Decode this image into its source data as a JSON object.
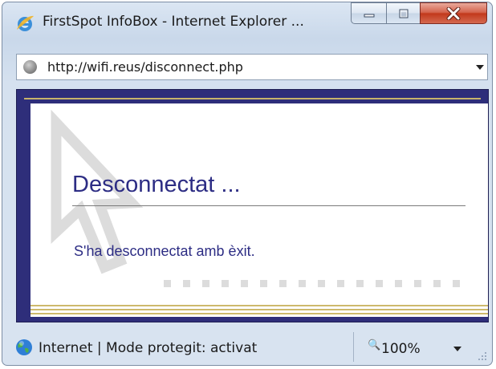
{
  "window": {
    "title": "FirstSpot InfoBox - Internet Explorer ...",
    "icons": {
      "app": "internet-explorer-icon",
      "minimize": "minimize-icon",
      "maximize": "maximize-icon",
      "close": "close-icon"
    }
  },
  "addressbar": {
    "url": "http://wifi.reus/disconnect.php",
    "icon": "page-icon"
  },
  "page": {
    "heading": "Desconnectat ...",
    "message": "S'ha desconnectat amb èxit.",
    "colors": {
      "frame": "#2e2e7a",
      "text": "#2d2d84",
      "gold": "#cdb96c"
    }
  },
  "statusbar": {
    "zone_text": "Internet | Mode protegit: activat",
    "zoom": "100%",
    "icons": {
      "zone": "globe-icon",
      "zoom": "zoom-icon"
    }
  }
}
